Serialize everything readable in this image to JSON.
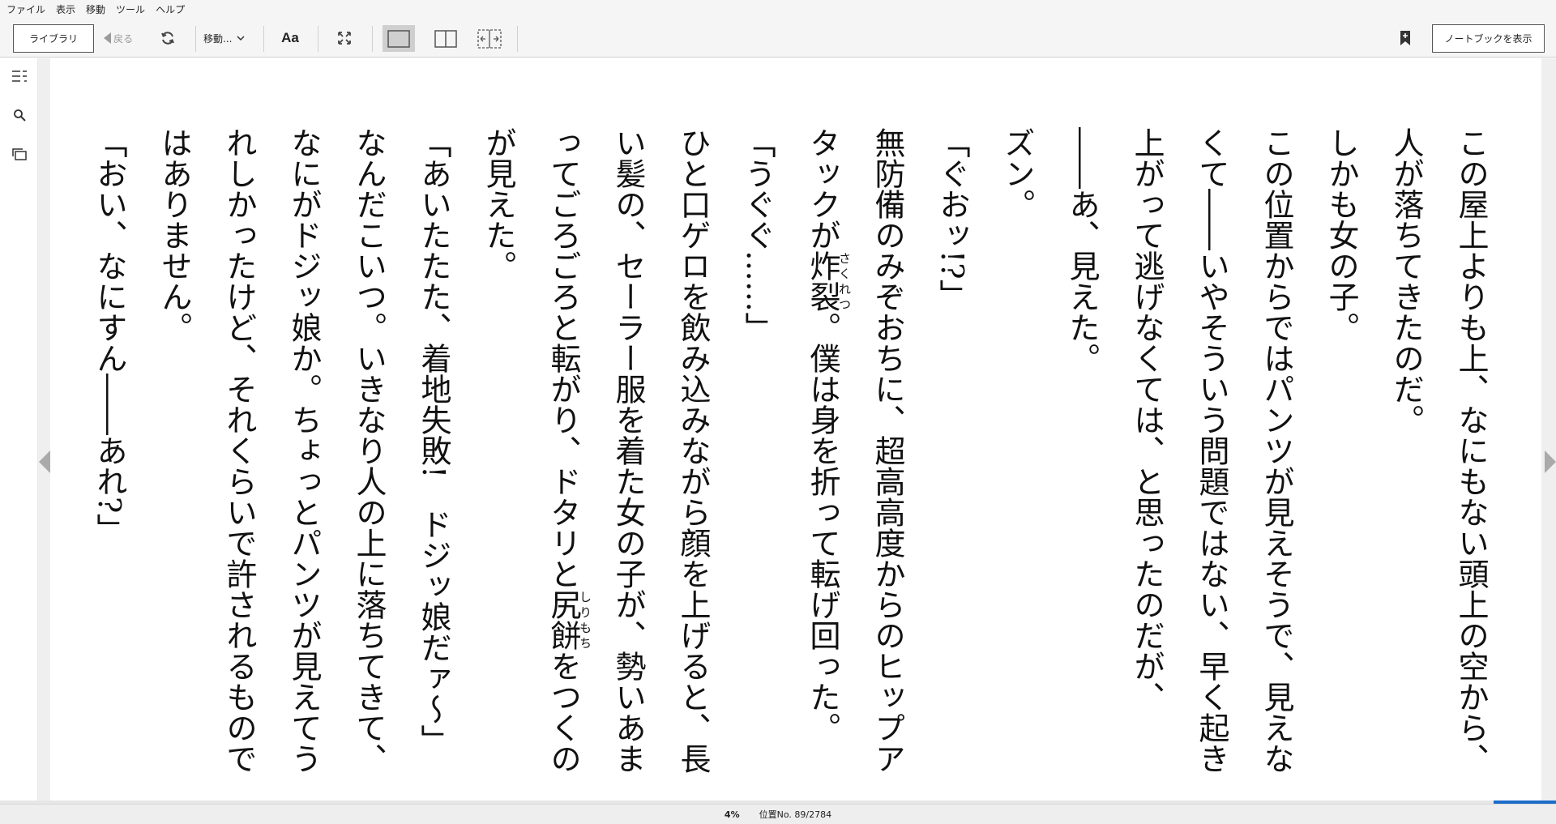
{
  "menu": [
    "ファイル",
    "表示",
    "移動",
    "ツール",
    "ヘルプ"
  ],
  "toolbar": {
    "library_label": "ライブラリ",
    "back_label": "戻る",
    "goto_label": "移動...",
    "font_label": "Aa",
    "notebook_label": "ノートブックを表示"
  },
  "sidebar": {
    "icons": [
      "table-of-contents-icon",
      "search-icon",
      "flashcards-icon"
    ]
  },
  "content": {
    "p1": "この屋上よりも上、なにもない頭上の空から、人が落ちてきたのだ。",
    "p2": "しかも女の子。",
    "p3": "この位置からではパンツが見えそうで、見えなくて――いやそういう問題ではない、早く起き上がって逃げなくては、と思ったのだが、",
    "p4": "――あ、見えた。",
    "p5": "ズン。",
    "p6": "「ぐおッ!?」",
    "p7_pre": "無防備のみぞおちに、超高高度からのヒップアタックが",
    "ruby1_base": "炸裂",
    "ruby1_rt": "さくれつ",
    "p7_post": "。僕は身を折って転げ回った。",
    "p8": "「うぐぐ……」",
    "p9_pre": "ひと口ゲロを飲み込みながら顔を上げると、長い髪の、セーラー服を着た女の子が、勢いあまってごろごろと転がり、ドタリと",
    "ruby2_base": "尻餅",
    "ruby2_rt": "しりもち",
    "p9_post": "をつくのが見えた。",
    "p10": "「あいたたた、着地失敗!　ドジッ娘だァ～」",
    "p11": "なんだこいつ。いきなり人の上に落ちてきて、なにがドジッ娘か。ちょっとパンツが見えてうれしかったけど、それくらいで許されるものではありません。",
    "p12": "「おい、なにすん――あれ?」"
  },
  "status": {
    "percent": "4%",
    "location": "位置No. 89/2784",
    "progress_fraction": 0.04
  },
  "colors": {
    "accent": "#1c6cc9",
    "toolbar_bg": "#f5f5f5",
    "page_bg": "#ffffff"
  }
}
